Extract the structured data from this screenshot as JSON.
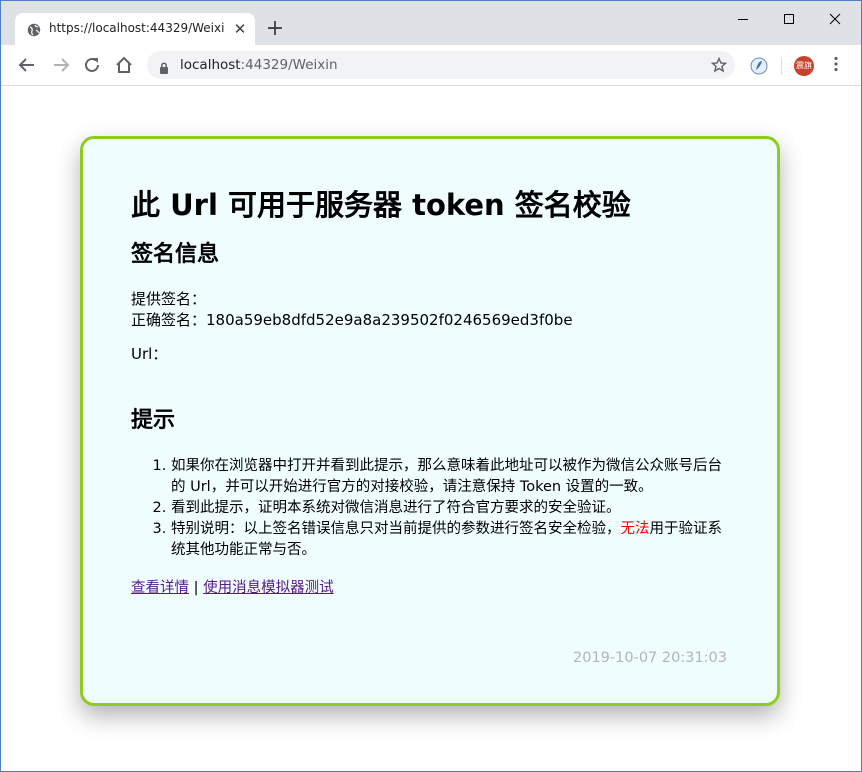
{
  "browser": {
    "tab_title": "https://localhost:44329/Weixin",
    "address_host": "localhost",
    "address_rest": ":44329/Weixin",
    "avatar_text": "震旗"
  },
  "page": {
    "title": "此 Url 可用于服务器 token 签名校验",
    "section_signature": "签名信息",
    "provided_label": "提供签名：",
    "provided_value": "",
    "correct_label": "正确签名：",
    "correct_value": "180a59eb8dfd52e9a8a239502f0246569ed3f0be",
    "url_label": "Url：",
    "url_value": "",
    "section_tips": "提示",
    "tips": [
      "如果你在浏览器中打开并看到此提示，那么意味着此地址可以被作为微信公众账号后台的 Url，并可以开始进行官方的对接校验，请注意保持 Token 设置的一致。",
      "看到此提示，证明本系统对微信消息进行了符合官方要求的安全验证。"
    ],
    "tip3_before": "特别说明：以上签名错误信息只对当前提供的参数进行签名安全检验，",
    "tip3_red": "无法",
    "tip3_after": "用于验证系统其他功能正常与否。",
    "link_details": "查看详情",
    "link_separator": " | ",
    "link_simulator": "使用消息模拟器测试",
    "timestamp": "2019-10-07 20:31:03"
  },
  "colors": {
    "card_border": "#8fcc1d",
    "card_background": "#f0fdff",
    "warning_text": "#ff0000",
    "link": "#551a8b",
    "timestamp": "#b4b4b4"
  }
}
